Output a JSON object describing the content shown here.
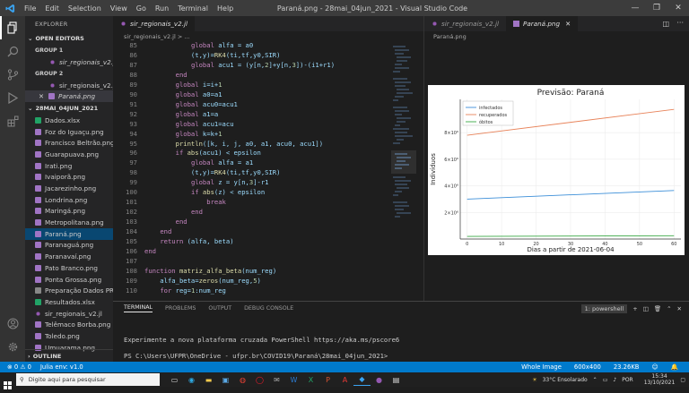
{
  "window": {
    "title": "Paraná.png - 28mai_04jun_2021 - Visual Studio Code"
  },
  "menu": [
    "File",
    "Edit",
    "Selection",
    "View",
    "Go",
    "Run",
    "Terminal",
    "Help"
  ],
  "sidebar": {
    "header": "EXPLORER",
    "open_editors": "OPEN EDITORS",
    "group1": "GROUP 1",
    "group1_files": [
      "sir_regionais_v2.jl"
    ],
    "group2": "GROUP 2",
    "group2_files": [
      "sir_regionais_v2.jl",
      "Paraná.png"
    ],
    "folder": "28MAI_04JUN_2021",
    "files": [
      "Dados.xlsx",
      "Foz do Iguaçu.png",
      "Francisco Beltrão.png",
      "Guarapuava.png",
      "Irati.png",
      "Ivaiporã.png",
      "Jacarezinho.png",
      "Londrina.png",
      "Maringá.png",
      "Metropolitana.png",
      "Paraná.png",
      "Paranaguá.png",
      "Paranavaí.png",
      "Pato Branco.png",
      "Ponta Grossa.png",
      "Preparação Dados PR...",
      "Resultados.xlsx",
      "sir_regionais_v2.jl",
      "Telêmaco Borba.png",
      "Toledo.png",
      "Umuarama.png"
    ],
    "outline": "OUTLINE"
  },
  "editor1": {
    "tab": "sir_regionais_v2.jl",
    "breadcrumb": "sir_regionais_v2.jl > ...",
    "lines": [
      {
        "n": "85",
        "t": "            global alfa = a0"
      },
      {
        "n": "86",
        "t": "            (t,y)=RK4(ti,tf,y0,SIR)"
      },
      {
        "n": "87",
        "t": "            global acu1 = (y[n,2]+y[n,3])-(i1+r1)"
      },
      {
        "n": "88",
        "t": "        end"
      },
      {
        "n": "89",
        "t": "        global i=i+1"
      },
      {
        "n": "90",
        "t": "        global a0=a1"
      },
      {
        "n": "91",
        "t": "        global acu0=acu1"
      },
      {
        "n": "92",
        "t": "        global a1=a"
      },
      {
        "n": "93",
        "t": "        global acu1=acu"
      },
      {
        "n": "94",
        "t": "        global k=k+1"
      },
      {
        "n": "95",
        "t": "        println([k, i, j, a0, a1, acu0, acu1])"
      },
      {
        "n": "96",
        "t": "        if abs(acu1) < epsilon"
      },
      {
        "n": "97",
        "t": "            global alfa = a1"
      },
      {
        "n": "98",
        "t": "            (t,y)=RK4(ti,tf,y0,SIR)"
      },
      {
        "n": "99",
        "t": "            global z = y[n,3]-r1"
      },
      {
        "n": "100",
        "t": "            if abs(z) < epsilon"
      },
      {
        "n": "101",
        "t": "                break"
      },
      {
        "n": "102",
        "t": "            end"
      },
      {
        "n": "103",
        "t": "        end"
      },
      {
        "n": "104",
        "t": "    end"
      },
      {
        "n": "105",
        "t": "    return (alfa, beta)"
      },
      {
        "n": "106",
        "t": "end"
      },
      {
        "n": "107",
        "t": ""
      },
      {
        "n": "108",
        "t": "function matriz_alfa_beta(num_reg)"
      },
      {
        "n": "109",
        "t": "    alfa_beta=zeros(num_reg,5)"
      },
      {
        "n": "110",
        "t": "    for reg=1:num_reg"
      }
    ]
  },
  "editor2": {
    "tabs": [
      "sir_regionais_v2.jl",
      "Paraná.png"
    ],
    "breadcrumb": "Paraná.png"
  },
  "chart_data": {
    "type": "line",
    "title": "Previsão: Paraná",
    "xlabel": "Dias a partir de 2021-06-04",
    "ylabel": "Indivíduos",
    "xlim": [
      -2,
      62
    ],
    "ylim": [
      0,
      10500000
    ],
    "xticks": [
      0,
      10,
      20,
      30,
      40,
      50,
      60
    ],
    "yticks": [
      {
        "v": 2000000,
        "label": "2×10⁶"
      },
      {
        "v": 4000000,
        "label": "4×10⁶"
      },
      {
        "v": 6000000,
        "label": "6×10⁶"
      },
      {
        "v": 8000000,
        "label": "8×10⁶"
      }
    ],
    "legend_position": "top-left",
    "series": [
      {
        "name": "infectados",
        "color": "#3b8ed8",
        "x": [
          0,
          60
        ],
        "y": [
          3000000,
          3650000
        ]
      },
      {
        "name": "recuperados",
        "color": "#e8835a",
        "x": [
          0,
          60
        ],
        "y": [
          7800000,
          9750000
        ]
      },
      {
        "name": "óbitos",
        "color": "#3aa845",
        "x": [
          0,
          60
        ],
        "y": [
          200000,
          250000
        ]
      }
    ]
  },
  "panel": {
    "tabs": [
      "TERMINAL",
      "PROBLEMS",
      "OUTPUT",
      "DEBUG CONSOLE"
    ],
    "shell": "1: powershell",
    "lines": [
      "Experimente a nova plataforma cruzada PowerShell https://aka.ms/pscore6",
      "PS C:\\Users\\UFPR\\OneDrive - ufpr.br\\COVID19\\Paraná\\28mai_04jun_2021>"
    ]
  },
  "status": {
    "left": [
      "⊗ 0 ⚠ 0",
      "Julia env: v1.0"
    ],
    "right": [
      "Whole Image",
      "600x400",
      "23.26KB"
    ]
  },
  "taskbar": {
    "search_placeholder": "Digite aqui para pesquisar",
    "weather": "33°C Ensolarado",
    "lang": "POR",
    "time": "15:34",
    "date": "13/10/2021"
  },
  "colors": {
    "accent": "#007acc",
    "activity": "#333333",
    "sidebar": "#252526"
  }
}
